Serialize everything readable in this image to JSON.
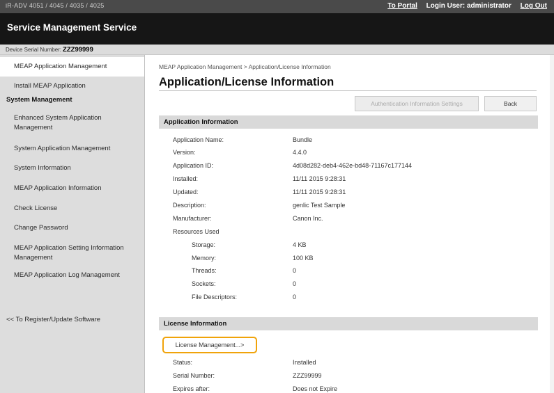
{
  "header": {
    "model_label": "iR-ADV 4051 / 4045 / 4035 / 4025",
    "to_portal": "To Portal",
    "login_user": "Login User: administrator",
    "logout": "Log Out"
  },
  "app_title": "Service Management Service",
  "device_serial": {
    "label": "Device Serial Number:",
    "value": "ZZZ99999"
  },
  "sidebar": {
    "items": [
      {
        "label": "MEAP Application Management"
      },
      {
        "label": "Install MEAP Application"
      },
      {
        "label": "System Management"
      },
      {
        "label": "Enhanced System Application Management"
      },
      {
        "label": "System Application Management"
      },
      {
        "label": "System Information"
      },
      {
        "label": "MEAP Application Information"
      },
      {
        "label": "Check License"
      },
      {
        "label": "Change Password"
      },
      {
        "label": "MEAP Application Setting Information Management"
      },
      {
        "label": "MEAP Application Log Management"
      },
      {
        "label": "<< To Register/Update Software"
      }
    ]
  },
  "main": {
    "breadcrumb": "MEAP Application Management > Application/License Information",
    "title": "Application/License Information",
    "buttons": {
      "auth_settings": "Authentication Information Settings",
      "back": "Back"
    },
    "app_info": {
      "heading": "Application Information",
      "rows": [
        {
          "label": "Application Name:",
          "value": "Bundle"
        },
        {
          "label": "Version:",
          "value": "4.4.0"
        },
        {
          "label": "Application ID:",
          "value": "4d08d282-deb4-462e-bd48-71167c177144"
        },
        {
          "label": "Installed:",
          "value": "11/11 2015 9:28:31"
        },
        {
          "label": "Updated:",
          "value": "11/11 2015 9:28:31"
        },
        {
          "label": "Description:",
          "value": "genlic Test Sample"
        },
        {
          "label": "Manufacturer:",
          "value": "Canon Inc."
        },
        {
          "label": "Resources Used",
          "value": ""
        },
        {
          "label": "Storage:",
          "value": "4 KB"
        },
        {
          "label": "Memory:",
          "value": "100 KB"
        },
        {
          "label": "Threads:",
          "value": "0"
        },
        {
          "label": "Sockets:",
          "value": "0"
        },
        {
          "label": "File Descriptors:",
          "value": "0"
        }
      ]
    },
    "license_info": {
      "heading": "License Information",
      "manage_button": "License Management...>",
      "rows": [
        {
          "label": "Status:",
          "value": "Installed"
        },
        {
          "label": "Serial Number:",
          "value": "ZZZ99999"
        },
        {
          "label": "Expires after:",
          "value": "Does not Expire"
        }
      ]
    }
  },
  "colors": {
    "topbar": "#4a4a4a",
    "titlebar": "#161616",
    "sidebar": "#dddddd",
    "section_header": "#d9d9d9",
    "highlight": "#f0a30a"
  }
}
